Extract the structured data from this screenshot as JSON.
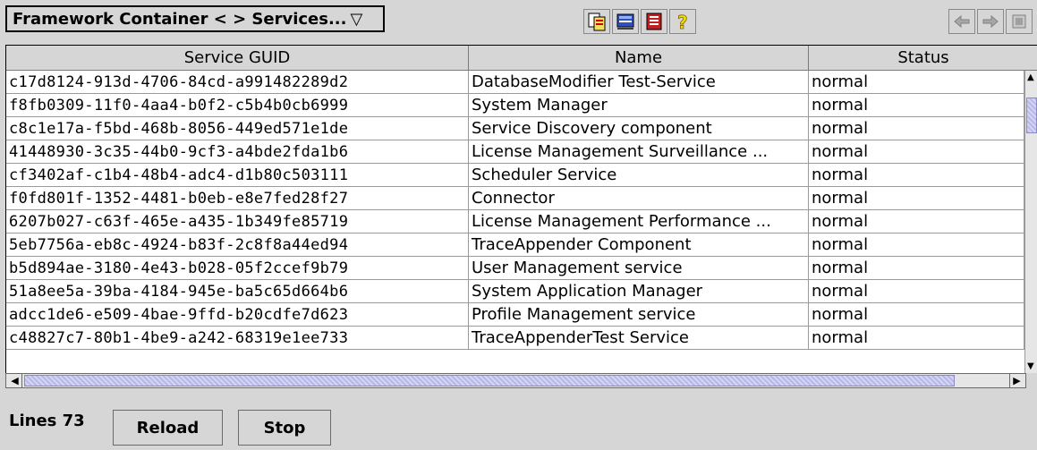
{
  "toolbar": {
    "title": "Framework Container < > Services...",
    "dropdown_arrow": "▽",
    "tools": [
      {
        "name": "copy-icon"
      },
      {
        "name": "monitor-icon"
      },
      {
        "name": "list-icon"
      },
      {
        "name": "help-icon"
      }
    ],
    "nav": [
      {
        "name": "back-icon"
      },
      {
        "name": "forward-icon"
      },
      {
        "name": "refresh-icon"
      }
    ]
  },
  "table": {
    "headers": [
      "Service GUID",
      "Name",
      "Status"
    ],
    "rows": [
      {
        "guid": "c17d8124-913d-4706-84cd-a991482289d2",
        "name": "DatabaseModifier Test-Service",
        "status": "normal"
      },
      {
        "guid": "f8fb0309-11f0-4aa4-b0f2-c5b4b0cb6999",
        "name": "System Manager",
        "status": "normal"
      },
      {
        "guid": "c8c1e17a-f5bd-468b-8056-449ed571e1de",
        "name": "Service Discovery component",
        "status": "normal"
      },
      {
        "guid": "41448930-3c35-44b0-9cf3-a4bde2fda1b6",
        "name": "License Management Surveillance ...",
        "status": "normal"
      },
      {
        "guid": "cf3402af-c1b4-48b4-adc4-d1b80c503111",
        "name": "Scheduler Service",
        "status": "normal"
      },
      {
        "guid": "f0fd801f-1352-4481-b0eb-e8e7fed28f27",
        "name": "Connector",
        "status": "normal"
      },
      {
        "guid": "6207b027-c63f-465e-a435-1b349fe85719",
        "name": "License Management Performance ...",
        "status": "normal"
      },
      {
        "guid": "5eb7756a-eb8c-4924-b83f-2c8f8a44ed94",
        "name": "TraceAppender Component",
        "status": "normal"
      },
      {
        "guid": "b5d894ae-3180-4e43-b028-05f2ccef9b79",
        "name": "User Management service",
        "status": "normal"
      },
      {
        "guid": "51a8ee5a-39ba-4184-945e-ba5c65d664b6",
        "name": "System Application Manager",
        "status": "normal"
      },
      {
        "guid": "adcc1de6-e509-4bae-9ffd-b20cdfe7d623",
        "name": "Profile Management service",
        "status": "normal"
      },
      {
        "guid": "c48827c7-80b1-4be9-a242-68319e1ee733",
        "name": "TraceAppenderTest Service",
        "status": "normal"
      }
    ]
  },
  "footer": {
    "lines_label": "Lines 73",
    "reload_label": "Reload",
    "stop_label": "Stop"
  },
  "colors": {
    "background": "#d6d6d6",
    "scroll_thumb": "#c4c4ee"
  }
}
